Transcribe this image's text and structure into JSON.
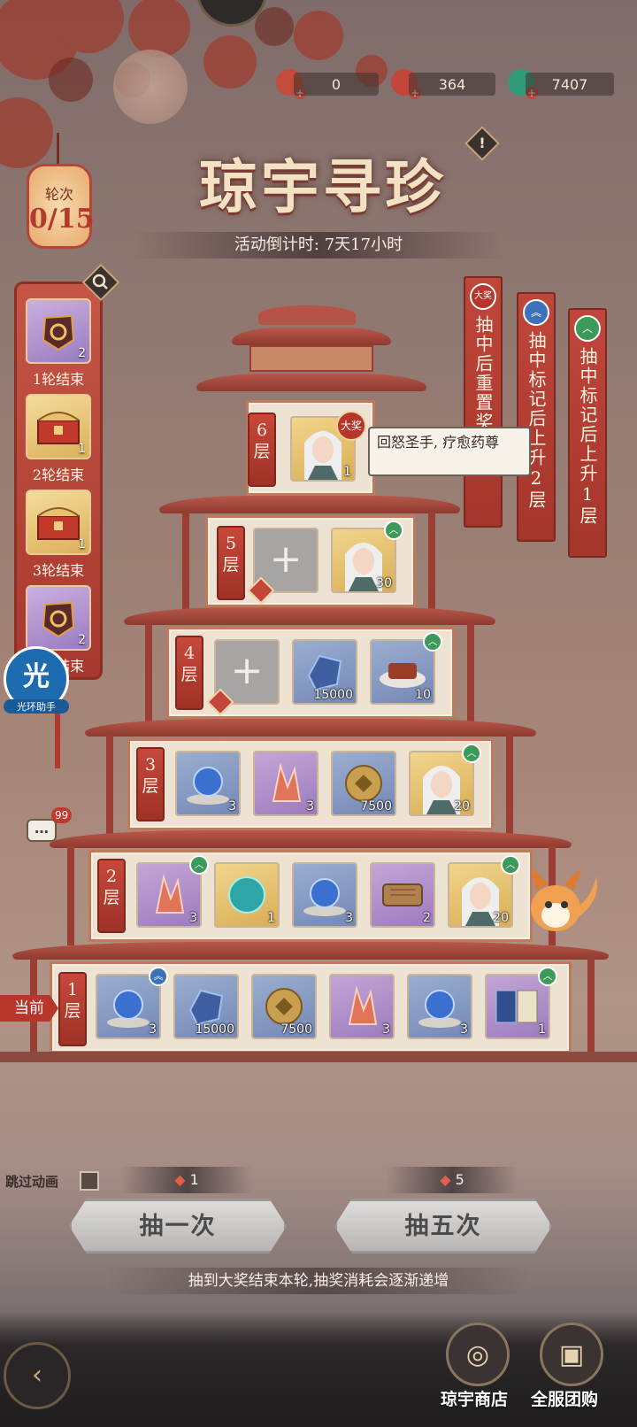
{
  "currencies": [
    {
      "icon": "draw-ticket-icon",
      "value": "0"
    },
    {
      "icon": "red-fan-icon",
      "value": "364"
    },
    {
      "icon": "jade-coin-icon",
      "value": "7407"
    }
  ],
  "title": "琼宇寻珍",
  "countdown": "活动倒计时: 7天17小时",
  "round": {
    "label": "轮次",
    "value": "0/15"
  },
  "round_rewards": [
    {
      "label": "1轮结束",
      "count": "2",
      "rarity": "purple",
      "icon": "armor-icon"
    },
    {
      "label": "2轮结束",
      "count": "1",
      "rarity": "gold",
      "icon": "chest-icon"
    },
    {
      "label": "3轮结束",
      "count": "1",
      "rarity": "gold",
      "icon": "chest-icon"
    },
    {
      "label": "4轮结束",
      "count": "2",
      "rarity": "purple",
      "icon": "armor-icon"
    }
  ],
  "helper": {
    "glyph": "光",
    "label": "光环助手"
  },
  "chat_badge": "99",
  "banners": [
    {
      "badge": "大奖",
      "text": "抽中后重置奖励"
    },
    {
      "badge": "︽",
      "text": "抽中标记后上升2层"
    },
    {
      "badge": "︿",
      "text": "抽中标记后上升1层"
    }
  ],
  "floors": {
    "f6": {
      "tag": "6层",
      "grand_badge": "大奖",
      "tooltip": "回怒圣手, 疗愈药尊",
      "items": [
        {
          "rarity": "gold",
          "icon": "hero-portrait",
          "count": "1"
        }
      ]
    },
    "f5": {
      "tag": "5层",
      "items": [
        {
          "rarity": "empty",
          "icon": "plus-icon",
          "count": ""
        },
        {
          "rarity": "gold",
          "icon": "hero-portrait",
          "count": "30",
          "up": "green"
        }
      ]
    },
    "f4": {
      "tag": "4层",
      "items": [
        {
          "rarity": "empty",
          "icon": "plus-icon",
          "count": ""
        },
        {
          "rarity": "blue",
          "icon": "blue-crystal-icon",
          "count": "15000"
        },
        {
          "rarity": "blue",
          "icon": "meat-icon",
          "count": "10",
          "up": "green"
        }
      ]
    },
    "f3": {
      "tag": "3层",
      "items": [
        {
          "rarity": "blue",
          "icon": "blue-orb-icon",
          "count": "3"
        },
        {
          "rarity": "purple",
          "icon": "pink-crystal-icon",
          "count": "3"
        },
        {
          "rarity": "blue",
          "icon": "copper-coin-icon",
          "count": "7500"
        },
        {
          "rarity": "gold",
          "icon": "hero-portrait",
          "count": "20",
          "up": "green"
        }
      ]
    },
    "f2": {
      "tag": "2层",
      "items": [
        {
          "rarity": "purple",
          "icon": "pink-crystal-icon",
          "count": "3",
          "up": "green"
        },
        {
          "rarity": "gold",
          "icon": "teal-orb-icon",
          "count": "1"
        },
        {
          "rarity": "blue",
          "icon": "blue-orb-icon",
          "count": "3"
        },
        {
          "rarity": "purple",
          "icon": "scroll-icon",
          "count": "2"
        },
        {
          "rarity": "gold",
          "icon": "hero-portrait",
          "count": "20",
          "up": "green"
        }
      ]
    },
    "f1": {
      "tag": "1层",
      "current": "当前",
      "items": [
        {
          "rarity": "blue",
          "icon": "blue-orb-icon",
          "count": "3",
          "up": "blue"
        },
        {
          "rarity": "blue",
          "icon": "blue-crystal-icon",
          "count": "15000"
        },
        {
          "rarity": "blue",
          "icon": "copper-coin-icon",
          "count": "7500"
        },
        {
          "rarity": "purple",
          "icon": "pink-crystal-icon",
          "count": "3"
        },
        {
          "rarity": "blue",
          "icon": "blue-orb-icon",
          "count": "3"
        },
        {
          "rarity": "purple",
          "icon": "book-icon",
          "count": "1",
          "up": "green"
        }
      ]
    }
  },
  "controls": {
    "skip_label": "跳过动画",
    "draw_one": {
      "label": "抽一次",
      "cost": "1"
    },
    "draw_five": {
      "label": "抽五次",
      "cost": "5"
    },
    "tip": "抽到大奖结束本轮,抽奖消耗会逐渐递增"
  },
  "bottom_nav": {
    "shop_label": "琼宇商店",
    "group_buy_label": "全服团购"
  }
}
